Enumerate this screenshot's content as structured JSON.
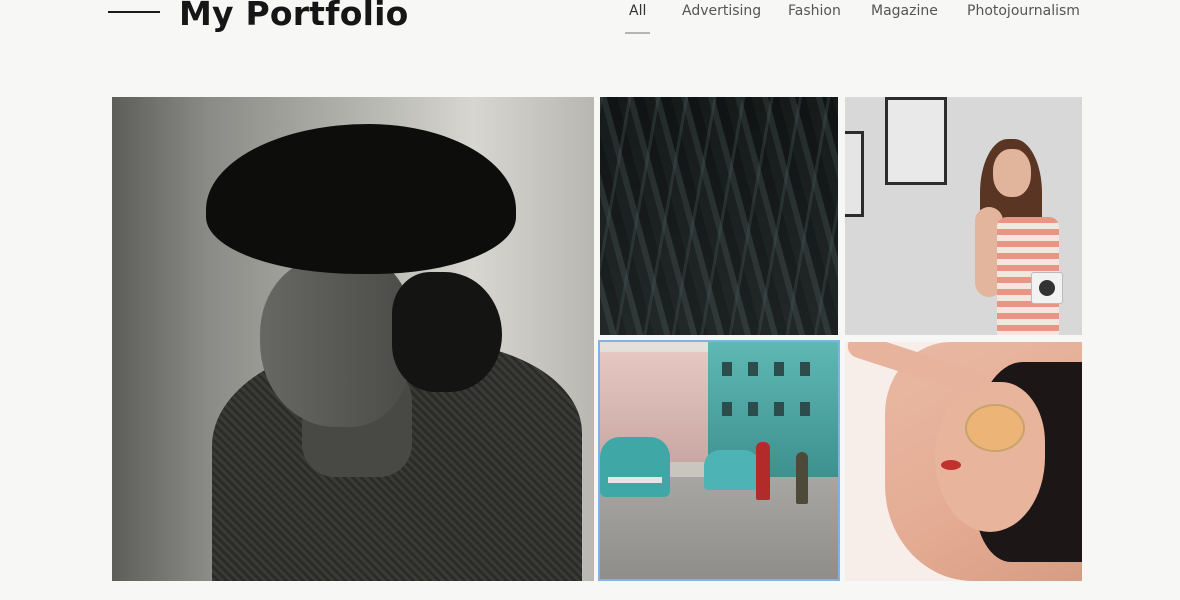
{
  "header": {
    "brand": "My Portfolio"
  },
  "nav": {
    "items": [
      {
        "label": "All",
        "active": true
      },
      {
        "label": "Advertising",
        "active": false
      },
      {
        "label": "Fashion",
        "active": false
      },
      {
        "label": "Magazine",
        "active": false
      },
      {
        "label": "Photojournalism",
        "active": false
      }
    ]
  },
  "gallery": {
    "tiles": [
      {
        "subject": "woman-fur-hat-portrait"
      },
      {
        "subject": "dark-feathers"
      },
      {
        "subject": "woman-striped-dress"
      },
      {
        "subject": "havana-street-cars",
        "selected": true
      },
      {
        "subject": "woman-sunglasses"
      }
    ]
  },
  "colors": {
    "background": "#f7f7f5",
    "brand_text": "#161616",
    "nav_text": "#555555",
    "active_underline": "#b5b5b5",
    "selected_border": "#7fb3e7"
  }
}
